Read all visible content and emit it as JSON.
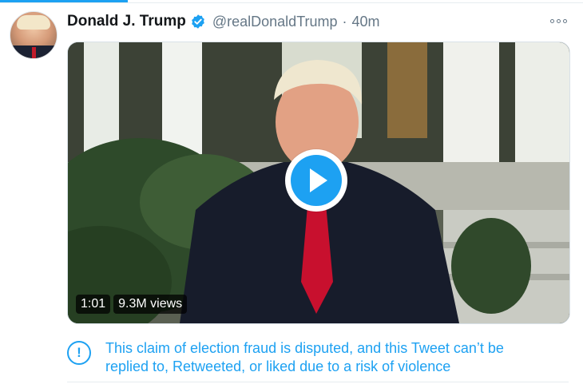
{
  "tweet": {
    "author_name": "Donald J. Trump",
    "handle": "@realDonaldTrump",
    "separator": "·",
    "timestamp": "40m",
    "verified_icon": "verified-badge-icon",
    "more_icon": "more-options-icon"
  },
  "video": {
    "duration": "1:01",
    "views": "9.3M views",
    "play_icon": "play-icon"
  },
  "notice": {
    "icon": "exclamation-circle-icon",
    "glyph": "!",
    "line1": "This claim of election fraud is disputed, and this Tweet can’t be",
    "line2": "replied to, Retweeted, or liked due to a risk of violence"
  },
  "colors": {
    "accent": "#1da1f2",
    "secondary_text": "#657786",
    "primary_text": "#14171a"
  }
}
